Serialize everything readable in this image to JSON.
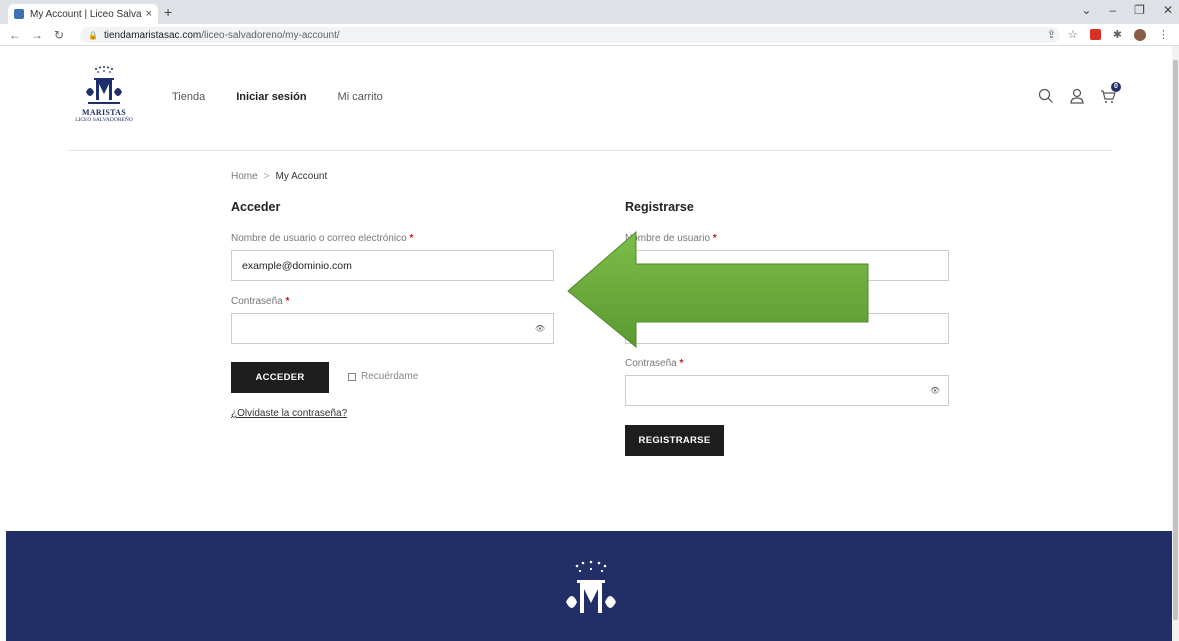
{
  "browser": {
    "tab_title": "My Account | Liceo Salvadoreño",
    "tab_close": "×",
    "new_tab": "+",
    "url_host": "tiendamaristasac.com",
    "url_path": "/liceo-salvadoreno/my-account/"
  },
  "header": {
    "logo_line1": "MARISTAS",
    "logo_line2": "LICEO SALVADOREÑO",
    "nav": [
      "Tienda",
      "Iniciar sesión",
      "Mi carrito"
    ],
    "cart_count": "0"
  },
  "breadcrumb": {
    "home": "Home",
    "separator": ">",
    "current": "My Account"
  },
  "login": {
    "heading": "Acceder",
    "username_label": "Nombre de usuario o correo electrónico",
    "username_value": "example@dominio.com",
    "password_label": "Contraseña",
    "submit": "ACCEDER",
    "remember": "Recuérdame",
    "forgot": "¿Olvidaste la contraseña?"
  },
  "register": {
    "heading": "Registrarse",
    "username_label": "Nombre de usuario",
    "password_label": "Contraseña",
    "submit": "REGISTRARSE"
  },
  "required_mark": "*",
  "colors": {
    "brand_navy": "#222f66",
    "button": "#1e1e1e",
    "required": "#c4161c",
    "arrow": "#6aab3c"
  }
}
